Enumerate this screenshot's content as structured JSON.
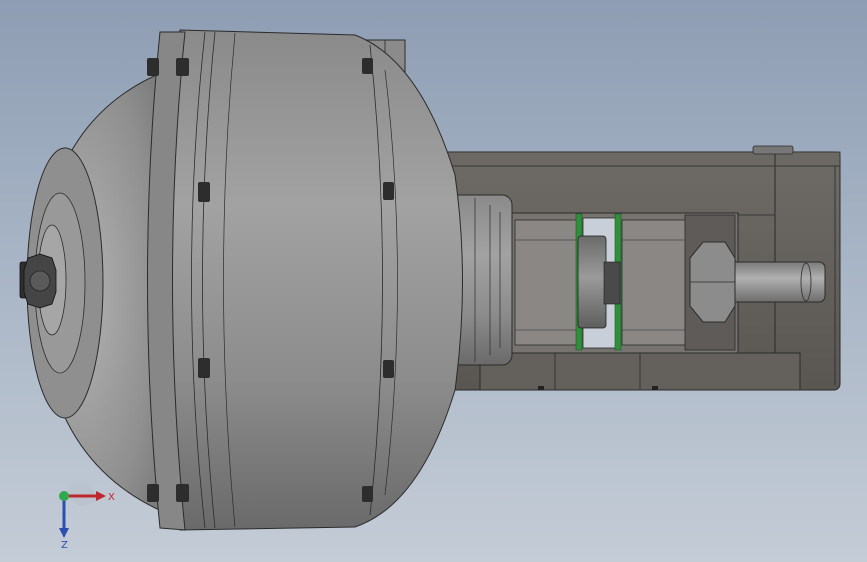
{
  "viewport": {
    "colors": {
      "background_top": "#8e9db3",
      "background_bottom": "#c4ccd6",
      "body_metal": "#8d8d8d",
      "dark_metal": "#5d5a57",
      "edge": "#2b2b2b",
      "coupling_green": "#2f8f3a",
      "axis_x": "#c0272d",
      "axis_y": "#2fa84f",
      "axis_z": "#2b4fb0"
    }
  },
  "triad": {
    "x_label": "X",
    "z_label": "Z"
  }
}
